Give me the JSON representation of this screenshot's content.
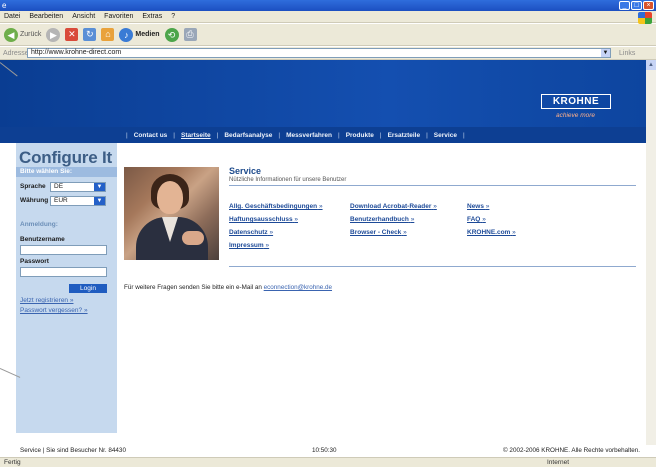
{
  "window": {
    "menu": [
      "Datei",
      "Bearbeiten",
      "Ansicht",
      "Favoriten",
      "Extras",
      "?"
    ]
  },
  "toolbar": {
    "back_label": "Zurück",
    "media_label": "Medien"
  },
  "address": {
    "label": "Adresse",
    "url": "http://www.krohne-direct.com",
    "links_label": "Links"
  },
  "site": {
    "logo": "KROHNE",
    "tagline": "achieve more",
    "nav": [
      "Contact us",
      "Startseite",
      "Bedarfsanalyse",
      "Messverfahren",
      "Produkte",
      "Ersatzteile",
      "Service"
    ]
  },
  "sidebar": {
    "heading": "Configure It",
    "settings_header": "Bitte wählen Sie:",
    "language_label": "Sprache",
    "language_value": "DE",
    "currency_label": "Währung",
    "currency_value": "EUR",
    "login_header": "Anmeldung:",
    "username_label": "Benutzername",
    "password_label": "Passwort",
    "login_button": "Login",
    "register_link": "Jetzt registrieren »",
    "forgot_link": "Passwort vergessen? »"
  },
  "service": {
    "title": "Service",
    "subtitle": "Nützliche Informationen für unsere Benutzer",
    "links": {
      "agb": "Allg. Geschäftsbedingungen",
      "haftung": "Haftungsausschluss",
      "datenschutz": "Datenschutz",
      "impressum": "Impressum",
      "acrobat": "Download Acrobat-Reader",
      "handbuch": "Benutzerhandbuch",
      "browser": "Browser - Check",
      "news": "News",
      "faq": "FAQ",
      "krohne": "KROHNE.com"
    },
    "arrow": "»",
    "contact_text": "Für weitere Fragen senden Sie bitte ein e-Mail an",
    "contact_email": "econnection@krohne.de"
  },
  "footer": {
    "left": "Service | Sie sind Besucher Nr. 84430",
    "time": "10:50:30",
    "right": "© 2002-2006 KROHNE. Alle Rechte vorbehalten."
  },
  "statusbar": {
    "left": "Fertig",
    "right": "Internet"
  }
}
